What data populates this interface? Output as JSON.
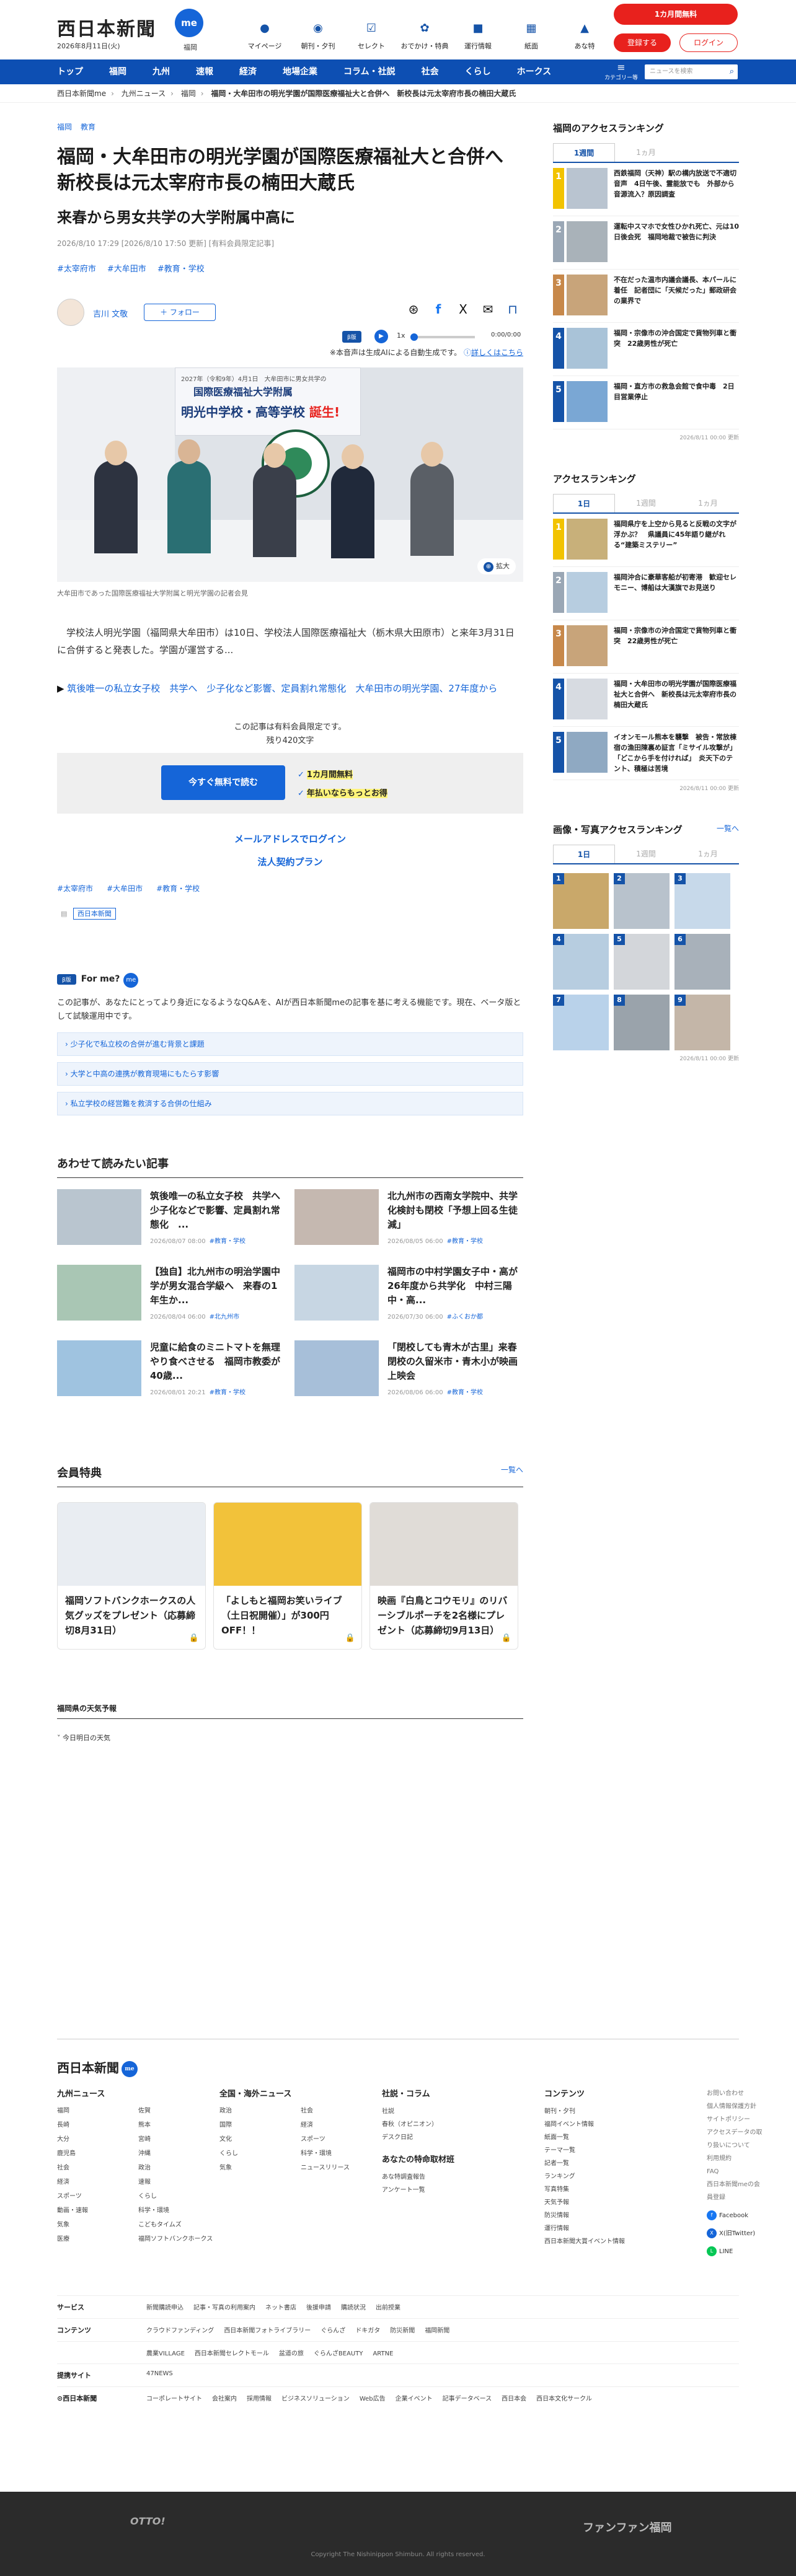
{
  "header": {
    "logo": "西日本新聞",
    "me": "me",
    "date": "2026年8月11日(火)",
    "sub": "福岡",
    "nav": [
      {
        "icon": "●",
        "label": "マイページ"
      },
      {
        "icon": "◉",
        "label": "朝刊・夕刊"
      },
      {
        "icon": "☑",
        "label": "セレクト"
      },
      {
        "icon": "✿",
        "label": "おでかけ・特典"
      },
      {
        "icon": "■",
        "label": "運行情報"
      },
      {
        "icon": "▦",
        "label": "紙面"
      },
      {
        "icon": "▲",
        "label": "あな特"
      }
    ],
    "subscribe": "1カ月間無料",
    "register": "登録する",
    "login": "ログイン"
  },
  "gnav": {
    "items": [
      "トップ",
      "福岡",
      "九州",
      "速報",
      "経済",
      "地場企業",
      "コラム・社説",
      "社会",
      "くらし",
      "ホークス"
    ],
    "menu_icon": "≡",
    "menu": "カテゴリー等",
    "search_placeholder": "ニュースを検索"
  },
  "breadcrumb": [
    "西日本新聞me",
    "九州ニュース",
    "福岡",
    "福岡・大牟田市の明光学園が国際医療福祉大と合併へ　新校長は元太宰府市長の楠田大蔵氏"
  ],
  "article": {
    "cats": [
      "福岡",
      "教育"
    ],
    "title": "福岡・大牟田市の明光学園が国際医療福祉大と合併へ　新校長は元太宰府市長の楠田大蔵氏",
    "subtitle": "来春から男女共学の大学附属中高に",
    "meta": "2026/8/10 17:29 [2026/8/10 17:50 更新] [有料会員限定記事]",
    "tags": [
      "#太宰府市",
      "#大牟田市",
      "#教育・学校"
    ],
    "author": "吉川 文敬",
    "follow": "＋ フォロー",
    "share": [
      "⊛",
      "f",
      "X",
      "✉",
      "⊓"
    ],
    "audio": {
      "badge": "β版",
      "speed": "1x",
      "time": "0:00/0:00",
      "progress": 0
    },
    "ai_note": "※本音声は生成AIによる自動生成です。",
    "ai_link": "詳しくはこちら",
    "photo": {
      "b1": "2027年（令和9年）4月1日　大牟田市に男女共学の",
      "b2": "国際医療福祉大学附属",
      "b3": "明光中学校・高等学校",
      "b4": "誕生!",
      "zoom_icon": "⊕",
      "zoom": "拡大"
    },
    "photo_caption": "大牟田市であった国際医療福祉大学附属と明光学園の記者会見",
    "lead": "　学校法人明光学園（福岡県大牟田市）は10日、学校法人国際医療福祉大（栃木県大田原市）と来年3月31日に合併すると発表した。学園が運営する...",
    "related_arrow": "▶",
    "related": "筑後唯一の私立女子校　共学へ　少子化など影響、定員割れ常態化　大牟田市の明光学園、27年度から",
    "paywall_note": "この記事は有料会員限定です。",
    "paywall_chars": "残り420文字",
    "free_btn": "今すぐ無料で読む",
    "check_icon": "✓",
    "check1": "1カ月間無料",
    "check2": "年払いならもっとお得",
    "email_login": "メールアドレスでログイン",
    "corp_plan": "法人契約プラン",
    "tags2": [
      "#太宰府市",
      "#大牟田市",
      "#教育・学校"
    ],
    "source": "西日本新聞"
  },
  "forme": {
    "badge": "β版",
    "title": "For me?",
    "me": "me",
    "text": "この記事が、あなたにとってより身近になるようなQ&Aを、AIが西日本新聞meの記事を基に考える機能です。現在、ベータ版として試験運用中です。",
    "qa": [
      "› 少子化で私立校の合併が進む背景と課題",
      "› 大学と中高の連携が教育現場にもたらす影響",
      "› 私立学校の経営難を救済する合併の仕組み"
    ]
  },
  "related_list": {
    "title": "あわせて読みたい記事",
    "items": [
      {
        "title": "筑後唯一の私立女子校　共学へ　少子化などで影響、定員割れ常態化　...",
        "date": "2026/08/07 08:00",
        "tag": "#教育・学校"
      },
      {
        "title": "北九州市の西南女学院中、共学化検討も閉校「予想上回る生徒減」",
        "date": "2026/08/05 06:00",
        "tag": "#教育・学校"
      },
      {
        "title": "【独自】北九州市の明治学園中学が男女混合学級へ　来春の1年生か...",
        "date": "2026/08/04 06:00",
        "tag": "#北九州市"
      },
      {
        "title": "福岡市の中村学園女子中・高が26年度から共学化　中村三陽中・高...",
        "date": "2026/07/30 06:00",
        "tag": "#ふくおか都"
      },
      {
        "title": "児童に給食のミニトマトを無理やり食べさせる　福岡市教委が40歳...",
        "date": "2026/08/01 20:21",
        "tag": "#教育・学校"
      },
      {
        "title": "「閉校しても青木が古里」来春閉校の久留米市・青木小が映画上映会",
        "date": "2026/08/06 06:00",
        "tag": "#教育・学校"
      }
    ]
  },
  "benefits": {
    "title": "会員特典",
    "more": "一覧へ",
    "lock_icon": "🔒",
    "items": [
      {
        "title": "福岡ソフトバンクホークスの人気グッズをプレゼント（応募締切8月31日）"
      },
      {
        "title": "「よしもと福岡お笑いライブ（土日祝開催）」が300円OFF！！"
      },
      {
        "title": "映画『白鳥とコウモリ』のリバーシブルポーチを2名様にプレゼント（応募締切9月13日）"
      }
    ]
  },
  "weather": {
    "title": "福岡県の天気予報",
    "row": "今日明日の天気"
  },
  "side": {
    "access1": {
      "title": "福岡のアクセスランキング",
      "tabs": [
        "1週間",
        "1ヵ月"
      ],
      "items": [
        "西鉄福岡（天神）駅の構内放送で不適切音声　4日午後、霊能放でも　外部から音源流入？原因調査",
        "運転中スマホで女性ひかれ死亡、元は10日後会死　福岡地裁で被告に判決",
        "不在だった温市内議会議長、本パールに着任　記者団に「天候だった」郵政研会の業界で",
        "福岡・宗像市の沖合国定で貨物列車と衝突　22歳男性が死亡",
        "福岡・直方市の救急会館で食中毒　2日目営業停止"
      ],
      "updated": "2026/8/11 00:00 更新"
    },
    "access2": {
      "title": "アクセスランキング",
      "tabs": [
        "1日",
        "1週間",
        "1ヵ月"
      ],
      "items": [
        "福岡県庁を上空から見ると反戦の文字が浮かぶ？　県議員に45年語り継がれる“建築ミステリー”",
        "福岡沖合に豪華客船が初寄港　歓迎セレモニー、博船は大漢旗でお見送り",
        "福岡・宗像市の沖合国定で貨物列車と衝突　22歳男性が死亡",
        "福岡・大牟田市の明光学園が国際医療福祉大と合併へ　新校長は元太宰府市長の楠田大蔵氏",
        "イオンモール熊本を襲撃　被告・常放棟宿の漁田陳裏め証言「ミサイル攻撃が」「どこから手を付ければ」　炎天下のテント、積極は苦境"
      ],
      "updated": "2026/8/11 00:00 更新"
    },
    "photos": {
      "title": "画像・写真アクセスランキング",
      "more": "一覧へ",
      "tabs": [
        "1日",
        "1週間",
        "1ヵ月"
      ],
      "nums": [
        "1",
        "2",
        "3",
        "4",
        "5",
        "6",
        "7",
        "8",
        "9"
      ],
      "updated": "2026/8/11 00:00 更新"
    }
  },
  "footer": {
    "logo": "西日本新聞",
    "me": "me",
    "cols": [
      {
        "title": "九州ニュース",
        "links": [
          "福岡",
          "佐賀",
          "長崎",
          "熊本",
          "大分",
          "宮崎",
          "鹿児島",
          "沖縄",
          "社会",
          "政治",
          "経済",
          "速報",
          "スポーツ",
          "くらし",
          "動画・速報",
          "科学・環境",
          "気象",
          "こどもタイムズ",
          "医療",
          "福岡ソフトバンクホークス"
        ]
      },
      {
        "title": "全国・海外ニュース",
        "links": [
          "政治",
          "社会",
          "国際",
          "経済",
          "文化",
          "スポーツ",
          "くらし",
          "科学・環境",
          "気象",
          "ニュースリリース"
        ]
      },
      {
        "title": "社説・コラム",
        "links": [
          "社説",
          "春秋（オピニオン）",
          "デスク日記"
        ],
        "title2": "あなたの特命取材班",
        "links2": [
          "あな特調査報告",
          "アンケート一覧"
        ]
      },
      {
        "title": "コンテンツ",
        "links": [
          "朝刊・夕刊",
          "福岡イベント情報",
          "紙面一覧",
          "テーマ一覧",
          "記者一覧",
          "ランキング",
          "写真特集",
          "天気予報",
          "防災情報",
          "運行情報",
          "西日本新聞大賞イベント情報"
        ]
      }
    ],
    "small": [
      "お問い合わせ",
      "個人情報保護方針",
      "サイトポリシー",
      "アクセスデータの取り扱いについて",
      "利用規約",
      "FAQ",
      "西日本新聞meの会員登録"
    ],
    "sns": [
      {
        "icon": "f",
        "name": "Facebook",
        "color": "#1877f2"
      },
      {
        "icon": "X",
        "name": "X(旧Twitter)",
        "color": "#1565d8"
      },
      {
        "icon": "L",
        "name": "LINE",
        "color": "#06c755"
      }
    ],
    "rows": [
      {
        "h": "サービス",
        "links": [
          "新聞購読申込",
          "記事・写真の利用案内",
          "ネット書店",
          "後援申請",
          "購読状況",
          "出前授業"
        ]
      },
      {
        "h": "コンテンツ",
        "links": [
          "クラウドファンディング",
          "西日本新聞フォトライブラリー",
          "ぐらんざ",
          "ドキガタ",
          "防災新聞",
          "福岡新聞"
        ]
      },
      {
        "h": "",
        "links": [
          "農業VILLAGE",
          "西日本新聞セレクトモール",
          "盆道の旅",
          "ぐらんざBEAUTY",
          "ARTNE"
        ]
      },
      {
        "h": "提携サイト",
        "links": [
          "47NEWS"
        ]
      },
      {
        "h": "⊙西日本新聞",
        "links": [
          "コーポレートサイト",
          "会社案内",
          "採用情報",
          "ビジネスソリューション",
          "Web広告",
          "企業イベント",
          "記事データベース",
          "西日本会",
          "西日本文化サークル"
        ]
      }
    ],
    "otto": "OTTO!",
    "fun": "ファンファン福岡",
    "copyright": "Copyright The Nishinippon Shimbun. All rights reserved."
  }
}
